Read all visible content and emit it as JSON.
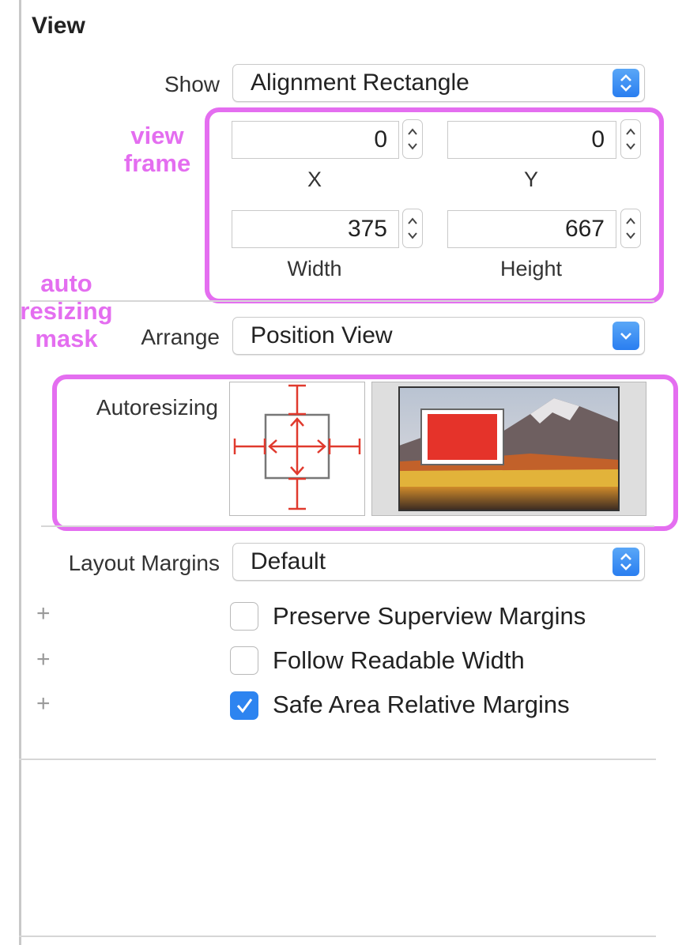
{
  "section": {
    "title": "View"
  },
  "show": {
    "label": "Show",
    "value": "Alignment Rectangle"
  },
  "frame": {
    "x": {
      "value": "0",
      "label": "X"
    },
    "y": {
      "value": "0",
      "label": "Y"
    },
    "width": {
      "value": "375",
      "label": "Width"
    },
    "height": {
      "value": "667",
      "label": "Height"
    }
  },
  "arrange": {
    "label": "Arrange",
    "value": "Position View"
  },
  "autoresizing": {
    "label": "Autoresizing"
  },
  "layout_margins": {
    "label": "Layout Margins",
    "value": "Default"
  },
  "options": [
    {
      "label": "Preserve Superview Margins",
      "checked": false
    },
    {
      "label": "Follow Readable Width",
      "checked": false
    },
    {
      "label": "Safe Area Relative Margins",
      "checked": true
    }
  ],
  "annotations": {
    "view_frame_line1": "view",
    "view_frame_line2": "frame",
    "mask_line1": "auto",
    "mask_line2": "resizing",
    "mask_line3": "mask"
  },
  "colors": {
    "annotation": "#e46ef0",
    "accent": "#2d84f0",
    "strut": "#e03a2e",
    "preview_view": "#e5332a"
  },
  "icons": {
    "popup": "up-down-chevron-icon",
    "dropdown": "chevron-down-icon",
    "stepper": "stepper-icon",
    "checkmark": "checkmark-icon"
  }
}
